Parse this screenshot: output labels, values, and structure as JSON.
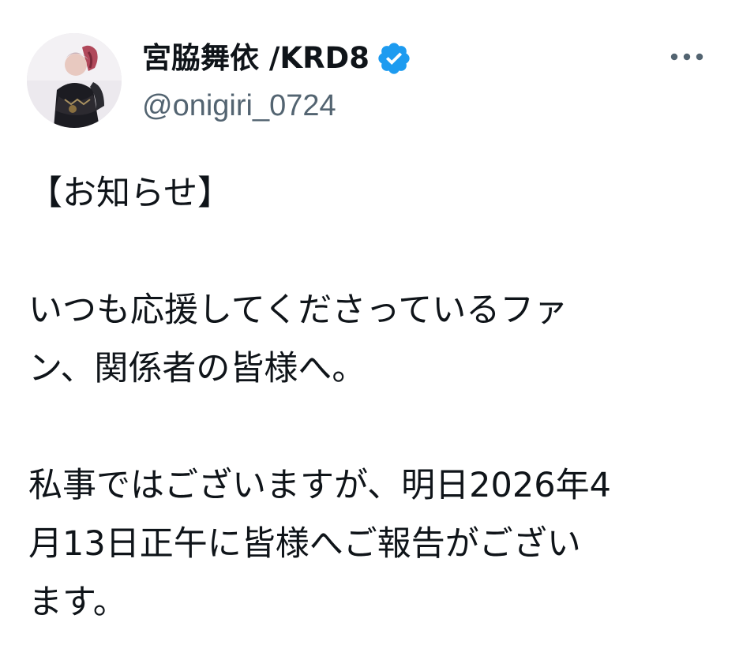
{
  "author": {
    "display_name": "宮脇舞依 /KRD8",
    "handle": "@onigiri_0724",
    "verified": true,
    "avatar_icon": "profile-photo",
    "verified_icon": "verified-badge-icon",
    "menu_icon": "more-options-icon"
  },
  "tweet": {
    "paragraphs": [
      "【お知らせ】",
      "いつも応援してくださっているファ\nン、関係者の皆様へ。",
      "私事ではございますが、明日2026年4\n月13日正午に皆様へご報告がござい\nます。"
    ]
  },
  "colors": {
    "text_primary": "#0f1419",
    "text_secondary": "#536471",
    "verified_blue": "#1d9bf0",
    "background": "#ffffff"
  }
}
